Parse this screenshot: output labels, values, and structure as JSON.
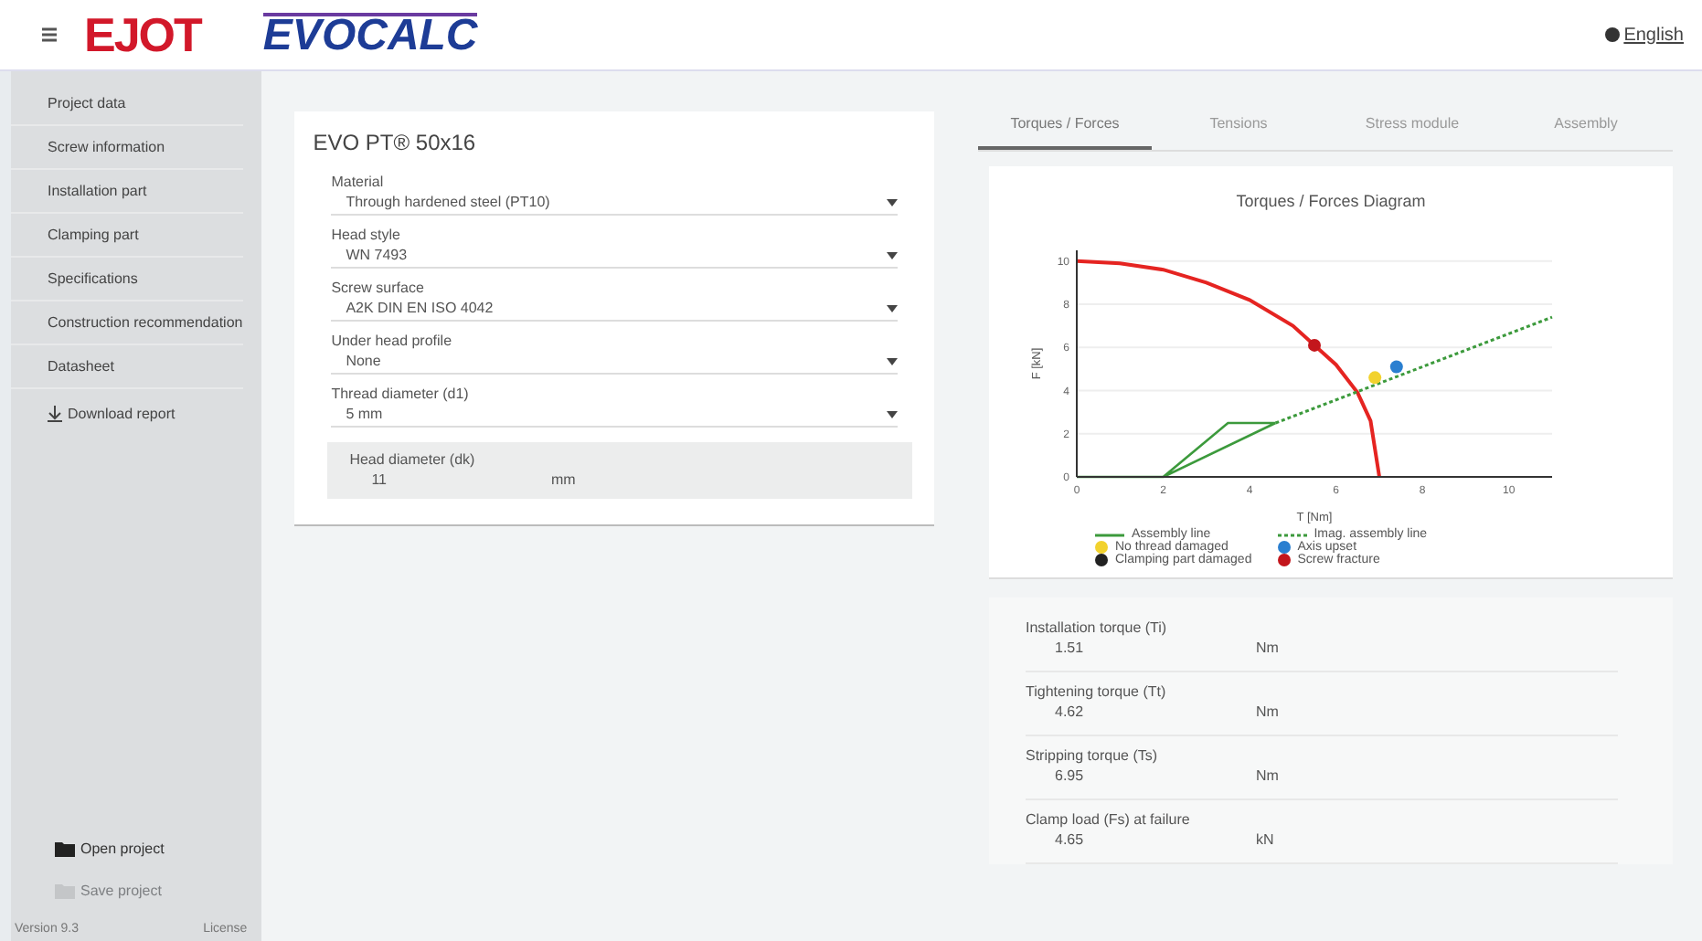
{
  "header": {
    "brand": "EJOT",
    "product": "EVOCALC",
    "language": "English"
  },
  "sidebar": {
    "items": [
      {
        "label": "Project data",
        "selected": false
      },
      {
        "label": "Screw information",
        "selected": false
      },
      {
        "label": "Installation part",
        "selected": false
      },
      {
        "label": "Clamping part",
        "selected": false
      },
      {
        "label": "Specifications",
        "selected": false
      },
      {
        "label": "Construction recommendation",
        "selected": false
      },
      {
        "label": "Datasheet",
        "selected": false
      }
    ],
    "download": "Download report",
    "actions": [
      {
        "label": "Open project",
        "disabled": false
      },
      {
        "label": "Save project",
        "disabled": true
      }
    ],
    "footer": {
      "version": "Version 9.3",
      "license": "License"
    }
  },
  "product": {
    "title": "EVO PT® 50x16",
    "fields": [
      {
        "kind": "select",
        "label": "Material",
        "value": "Through hardened steel (PT10)"
      },
      {
        "kind": "select",
        "label": "Head style",
        "value": "WN 7493"
      },
      {
        "kind": "select",
        "label": "Screw surface",
        "value": "A2K DIN EN ISO 4042"
      },
      {
        "kind": "select",
        "label": "Under head profile",
        "value": "None"
      },
      {
        "kind": "select",
        "label": "Thread diameter (d1)",
        "value": "5 mm"
      },
      {
        "kind": "readonly",
        "label": "Head diameter (dk)",
        "value": "11",
        "unit": "mm"
      }
    ]
  },
  "tabs": [
    {
      "label": "Torques / Forces",
      "selected": true
    },
    {
      "label": "Tensions",
      "selected": false
    },
    {
      "label": "Stress module",
      "selected": false
    },
    {
      "label": "Assembly",
      "selected": false
    }
  ],
  "chart_data": {
    "type": "line",
    "title": "Torques / Forces Diagram",
    "xlabel": "T [Nm]",
    "ylabel": "F [kN]",
    "xlim": [
      0,
      11
    ],
    "ylim": [
      0,
      10.5
    ],
    "grid": true,
    "xticks": [
      0,
      2,
      4,
      6,
      8,
      10
    ],
    "yticks": [
      0,
      2,
      4,
      6,
      8,
      10
    ],
    "series": [
      {
        "line_style": "solid",
        "color": "#e52421",
        "x": [
          0,
          1,
          2,
          3,
          4,
          5,
          6,
          6.5,
          6.8,
          7
        ],
        "values": [
          10,
          9.9,
          9.6,
          9,
          8.2,
          7,
          5.2,
          3.9,
          2.6,
          0
        ]
      },
      {
        "line_style": "solid",
        "name": "Assembly line",
        "color": "#3c9a3c",
        "x": [
          0,
          2,
          3.5,
          4.6,
          3.5,
          2,
          4.6
        ],
        "values": [
          0,
          0,
          2.5,
          2.5,
          2.5,
          0,
          2.5
        ]
      },
      {
        "line_style": "dashed",
        "name": "Imag. assembly line",
        "color": "#3c9a3c",
        "x": [
          4.6,
          11
        ],
        "values": [
          2.5,
          7.4
        ]
      },
      {
        "marker": "circle",
        "name": "No thread damaged",
        "color": "#f2d22e",
        "x": [
          6.9
        ],
        "values": [
          4.6
        ]
      },
      {
        "marker": "circle",
        "name": "Axis upset",
        "color": "#2a7fd0",
        "x": [
          7.4
        ],
        "values": [
          5.1
        ]
      },
      {
        "marker": "circle",
        "name": "Clamping part damaged",
        "color": "#222222"
      },
      {
        "marker": "circle",
        "name": "Screw fracture",
        "color": "#c3161c",
        "x": [
          5.5
        ],
        "values": [
          6.1
        ]
      }
    ]
  },
  "results": [
    {
      "label": "Installation torque (Ti)",
      "value": "1.51",
      "unit": "Nm"
    },
    {
      "label": "Tightening torque (Tt)",
      "value": "4.62",
      "unit": "Nm"
    },
    {
      "label": "Stripping torque (Ts)",
      "value": "6.95",
      "unit": "Nm"
    },
    {
      "label": "Clamp load (Fs) at failure",
      "value": "4.65",
      "unit": "kN"
    }
  ]
}
